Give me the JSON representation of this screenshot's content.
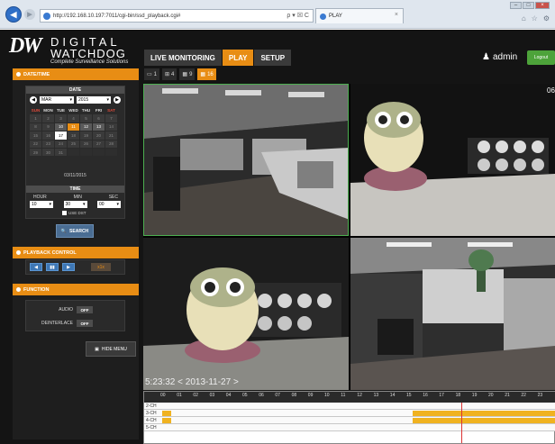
{
  "browser": {
    "url": "http://192.168.10.197:7011/cgi-bin/ssd_playback.cgi#",
    "address_controls": "ρ ▾ ☒ C",
    "tab_title": "PLAY",
    "tab_close": "×",
    "window_controls": [
      "–",
      "□",
      "×"
    ],
    "toolbar_icons": [
      "home-icon",
      "star-icon",
      "gear-icon"
    ]
  },
  "logo": {
    "mark": "DW",
    "line1": "DIGITAL",
    "line2": "WATCHDOG",
    "tagline": "Complete Surveillance Solutions"
  },
  "nav": {
    "items": [
      {
        "label": "LIVE MONITORING",
        "active": false
      },
      {
        "label": "PLAY",
        "active": true
      },
      {
        "label": "SETUP",
        "active": false
      }
    ]
  },
  "user": {
    "name": "admin",
    "logout_label": "Logout"
  },
  "sidebar": {
    "datetime_title": "DATE/TIME",
    "date_header": "DATE",
    "month_value": "MAR",
    "year_value": "2015",
    "weekdays": [
      "SUN",
      "MON",
      "TUE",
      "WED",
      "THU",
      "FRI",
      "SAT"
    ],
    "days": [
      "1",
      "2",
      "3",
      "4",
      "5",
      "6",
      "7",
      "8",
      "9",
      "10",
      "11",
      "12",
      "13",
      "14",
      "15",
      "16",
      "17",
      "18",
      "19",
      "20",
      "21",
      "22",
      "23",
      "24",
      "25",
      "26",
      "27",
      "28",
      "29",
      "30",
      "31"
    ],
    "date_label": "03/11/2015",
    "time_header": "TIME",
    "hour_label": "HOUR",
    "min_label": "MIN",
    "sec_label": "SEC",
    "hour_value": "10",
    "min_value": "30",
    "sec_value": "00",
    "dst_label": "USE DST",
    "search_label": "SEARCH",
    "playback_title": "PLAYBACK CONTROL",
    "playback_buttons": [
      "◀",
      "▮▮",
      "▶"
    ],
    "speed_label": "x1x",
    "function_title": "FUNCTION",
    "audio_label": "AUDIO",
    "audio_value": "OFF",
    "deinterlace_label": "DEINTERLACE",
    "deinterlace_value": "OFF",
    "hide_menu_label": "HIDE MENU"
  },
  "view_tabs": [
    {
      "label": "1",
      "active": false
    },
    {
      "label": "4",
      "active": false
    },
    {
      "label": "9",
      "active": false
    },
    {
      "label": "16",
      "active": true
    }
  ],
  "cameras": {
    "overlay_text": "5:23:32 < 2013-11-27 >",
    "corner_label": "06"
  },
  "timeline": {
    "hours": [
      "00",
      "01",
      "02",
      "03",
      "04",
      "05",
      "06",
      "07",
      "08",
      "09",
      "10",
      "11",
      "12",
      "13",
      "14",
      "15",
      "16",
      "17",
      "18",
      "19",
      "20",
      "21",
      "22",
      "23"
    ],
    "channels": [
      {
        "name": "2-CH"
      },
      {
        "name": "3-CH"
      },
      {
        "name": "4-CH"
      },
      {
        "name": "5-CH"
      }
    ]
  },
  "colors": {
    "accent": "#e88d14",
    "record_bar": "#f0b220",
    "cursor": "#dd3333"
  }
}
